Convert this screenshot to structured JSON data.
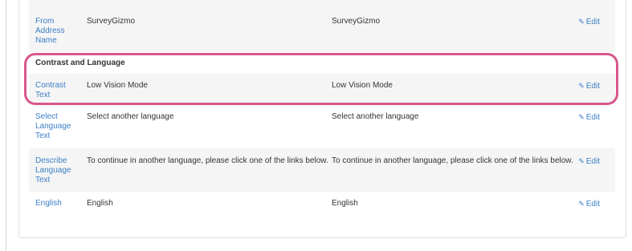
{
  "rows": [
    {
      "label": "From Address Name",
      "value1": "SurveyGizmo",
      "value2": "SurveyGizmo",
      "edit": "Edit"
    },
    {
      "label": "Contrast Text",
      "value1": "Low Vision Mode",
      "value2": "Low Vision Mode",
      "edit": "Edit"
    },
    {
      "label": "Select Language Text",
      "value1": "Select another language",
      "value2": "Select another language",
      "edit": "Edit"
    },
    {
      "label": "Describe Language Text",
      "value1": "To continue in another language, please click one of the links below.",
      "value2": "To continue in another language, please click one of the links below.",
      "edit": "Edit"
    },
    {
      "label": "English",
      "value1": "English",
      "value2": "English",
      "edit": "Edit"
    }
  ],
  "section": {
    "title": "Contrast and Language"
  },
  "colors": {
    "link": "#3b7fc4",
    "highlight": "#d9578c",
    "row_shade": "#f5f5f5"
  }
}
